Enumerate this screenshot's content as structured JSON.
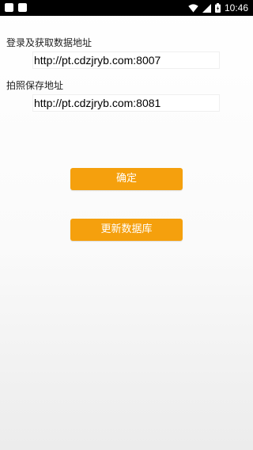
{
  "status_bar": {
    "time": "10:46",
    "icons": [
      "app-notification-icon",
      "app-notification-icon",
      "wifi-icon",
      "cellular-signal-icon",
      "battery-icon"
    ]
  },
  "form": {
    "login_label": "登录及获取数据地址",
    "login_value": "http://pt.cdzjryb.com:8007",
    "photo_label": "拍照保存地址",
    "photo_value": "http://pt.cdzjryb.com:8081"
  },
  "buttons": {
    "confirm_label": "确定",
    "update_db_label": "更新数据库"
  },
  "colors": {
    "accent": "#f5a00d",
    "status_bar": "#000000"
  }
}
